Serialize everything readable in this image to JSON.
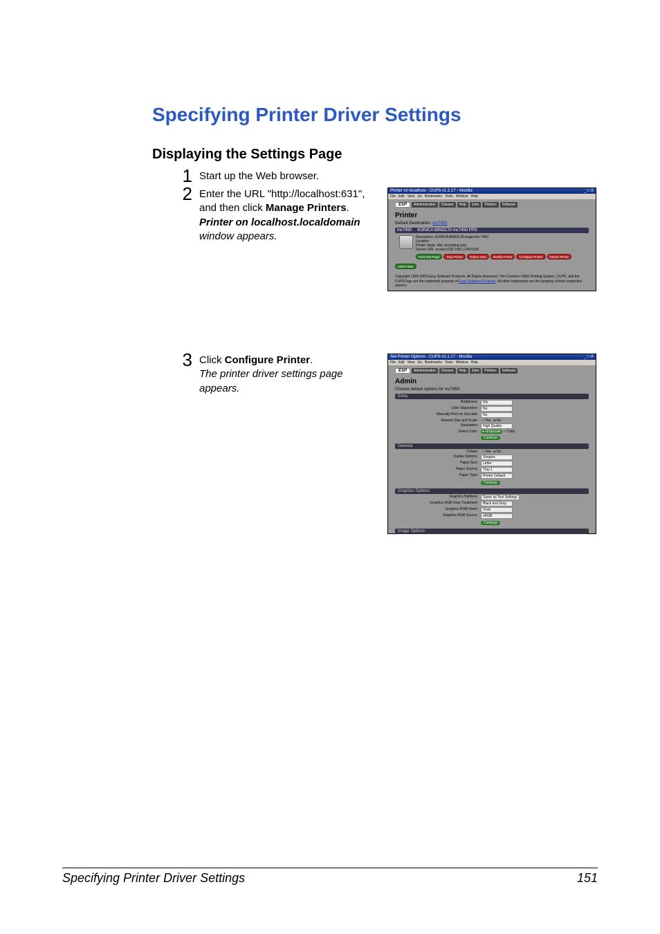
{
  "headings": {
    "h1": "Specifying Printer Driver Settings",
    "h2": "Displaying the Settings Page"
  },
  "steps": {
    "s1": {
      "num": "1",
      "text": "Start up the Web browser."
    },
    "s2": {
      "num": "2",
      "lead": "Enter the URL \"http://local­host:631\", and then click ",
      "bold1": "Manage Printers",
      "period": ".",
      "ital1": "Printer on localhost.local­domain",
      "ital2": " window appears."
    },
    "s3": {
      "num": "3",
      "lead": "Click ",
      "bold1": "Configure Printer",
      "period": ".",
      "ital": "The printer driver settings page appears."
    }
  },
  "shot1": {
    "title": "Printer on localhost - CUPS v1.1.17 - Mozilla",
    "winbtns": "_ □ X",
    "menu": [
      "File",
      "Edit",
      "View",
      "Go",
      "Bookmarks",
      "Tools",
      "Window",
      "Help"
    ],
    "esp": "ESP",
    "tabs": [
      "Administration",
      "Classes",
      "Help",
      "Jobs",
      "Printers",
      "Software"
    ],
    "heading": "Printer",
    "defaultDest": "Default Destination: ",
    "defaultLink": "mc7450",
    "barLeft": "mc7450",
    "barRight": "KONICA MINOLTA mc7450 PPD",
    "info": {
      "desc": "Description: KONICA MINOLTA magicolor 7450",
      "loc": "Location:",
      "state": "Printer State: idle, accepting jobs.",
      "uri": "Device URI: socket://192.168.1.249:9100"
    },
    "btns": {
      "test": "Print Test Page",
      "stop": "Stop Printer",
      "reject": "Reject Jobs",
      "modify": "Modify Printer",
      "config": "Configure Printer",
      "delete": "Delete Printer"
    },
    "addBtn": "Add Printer",
    "copy1": "Copyright 1993-2003 Easy Software Products, All Rights Reserved. The Common UNIX Printing System, CUPS, and the CUPS logo are the trademark property of ",
    "copyLink": "Easy Software Products",
    "copy2": ". All other trademarks are the property of their respective owners."
  },
  "shot2": {
    "title": "Set Printer Options - CUPS v1.1.17 - Mozilla",
    "winbtns": "_ □ X",
    "menu": [
      "File",
      "Edit",
      "View",
      "Go",
      "Bookmarks",
      "Tools",
      "Window",
      "Help"
    ],
    "esp": "ESP",
    "tabs": [
      "Administration",
      "Classes",
      "Help",
      "Jobs",
      "Printers",
      "Software"
    ],
    "heading": "Admin",
    "sub": "Choose default options for mc7450.",
    "sections": {
      "extra": {
        "title": "Extra",
        "rows": {
          "brightness": {
            "label": "Brightness:",
            "value": "0%"
          },
          "colorSep": {
            "label": "Color Separation:",
            "value": "No"
          },
          "manual2nd": {
            "label": "Manually Print on 2nd side:",
            "value": "No"
          },
          "nearest": {
            "label": "Nearest Size and Scale:",
            "yes": "Yes",
            "no": "No"
          },
          "resolution": {
            "label": "Resolution:",
            "value": "High Quality"
          },
          "selColor": {
            "label": "Select Color:",
            "gray": "Grayscale",
            "color": "Color"
          }
        },
        "continue": "Continue"
      },
      "general": {
        "title": "General",
        "rows": {
          "collate": {
            "label": "Collate:",
            "yes": "Yes",
            "no": "No"
          },
          "duplex": {
            "label": "Duplex Options:",
            "value": "Simplex"
          },
          "paperSize": {
            "label": "Paper Size:",
            "value": "Letter"
          },
          "paperSrc": {
            "label": "Paper Source:",
            "value": "Tray 1"
          },
          "paperType": {
            "label": "Paper Type:",
            "value": "Printer Default"
          }
        },
        "continue": "Continue"
      },
      "graphics": {
        "title": "Graphics Options",
        "rows": {
          "halftone": {
            "label": "Graphics Halftone:",
            "value": "Same as Text Settings"
          },
          "grayTreat": {
            "label": "Graphics RGB Gray Treatment:",
            "value": "Black and Gray"
          },
          "rgbIntent": {
            "label": "Graphics RGB Intent:",
            "value": "Vivid"
          },
          "rgbSource": {
            "label": "Graphics RGB Source:",
            "value": "sRGB"
          }
        },
        "continue": "Continue"
      },
      "image": {
        "title": "Image Options"
      }
    }
  },
  "footer": {
    "left": "Specifying Printer Driver Settings",
    "right": "151"
  }
}
